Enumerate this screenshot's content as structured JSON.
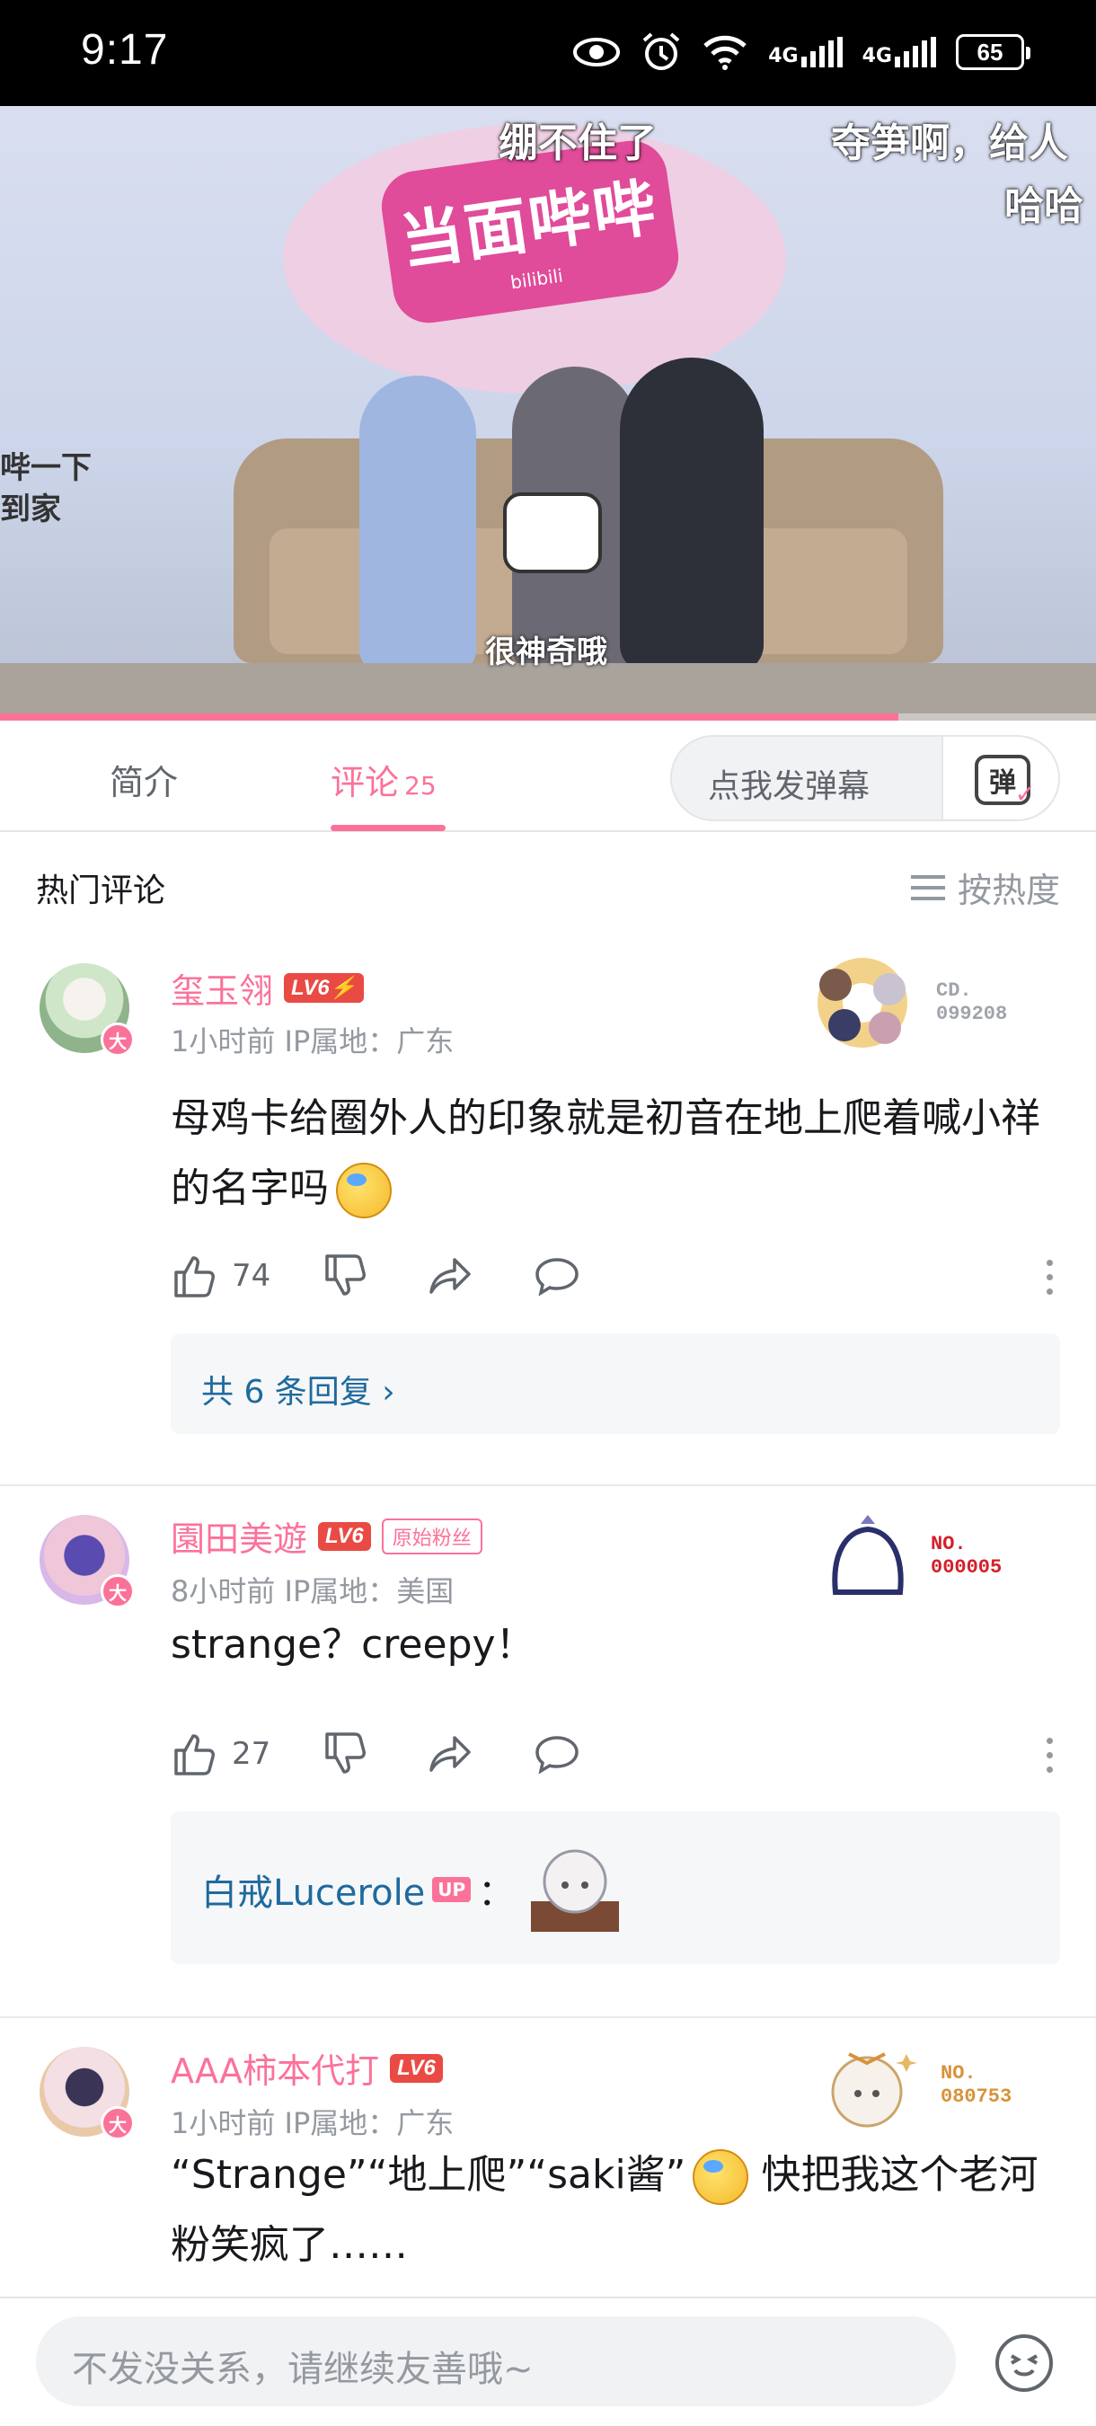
{
  "status_bar": {
    "time": "9:17",
    "battery": "65",
    "network1": "4G",
    "network2": "4G"
  },
  "video": {
    "danmaku": [
      {
        "text": "绷不住了"
      },
      {
        "text": "夺笋啊，给人"
      },
      {
        "text": "哈哈"
      }
    ],
    "logo_text": "当面哔哔",
    "logo_sub": "bilibili",
    "caption": "很神奇哦",
    "side_text": "哔一下\n到家",
    "progress": 0.82
  },
  "tabs": {
    "intro": "简介",
    "comments": "评论",
    "comments_count": "25",
    "danmaku_placeholder": "点我发弹幕",
    "danmaku_icon_label": "弹"
  },
  "hot": {
    "title": "热门评论",
    "sort_label": "按热度"
  },
  "comments": [
    {
      "username": "玺玉翎",
      "level": "LV6⚡",
      "time_ip": "1小时前 IP属地：广东",
      "text": "母鸡卡给圈外人的印象就是初音在地上爬着喊小祥的名字吗",
      "likes": "74",
      "reply_link": "共 6 条回复 ›",
      "decoration_no": "CD.\n099208",
      "decoration_color": "#a0a4aa"
    },
    {
      "username": "園田美遊",
      "level": "LV6",
      "fan_badge": "原始粉丝",
      "time_ip": "8小时前 IP属地：美国",
      "text": "strange？creepy！",
      "likes": "27",
      "reply_user": "白戒Lucerole",
      "reply_up": "UP",
      "reply_colon": "：",
      "decoration_no": "NO.\n000005",
      "decoration_color": "#d4202a"
    },
    {
      "username": "AAA柿本代打",
      "level": "LV6",
      "time_ip": "1小时前 IP属地：广东",
      "text_part1": "“Strange”“地上爬”“saki酱”",
      "text_part2": "快把我这个老河粉笑疯了……",
      "decoration_no": "NO.\n080753",
      "decoration_color": "#d8923a"
    }
  ],
  "bottom": {
    "placeholder": "不发没关系，请继续友善哦~"
  },
  "colors": {
    "accent": "#fb7299",
    "link": "#1e6a9e",
    "text": "#18191c",
    "secondary": "#9499a0"
  }
}
